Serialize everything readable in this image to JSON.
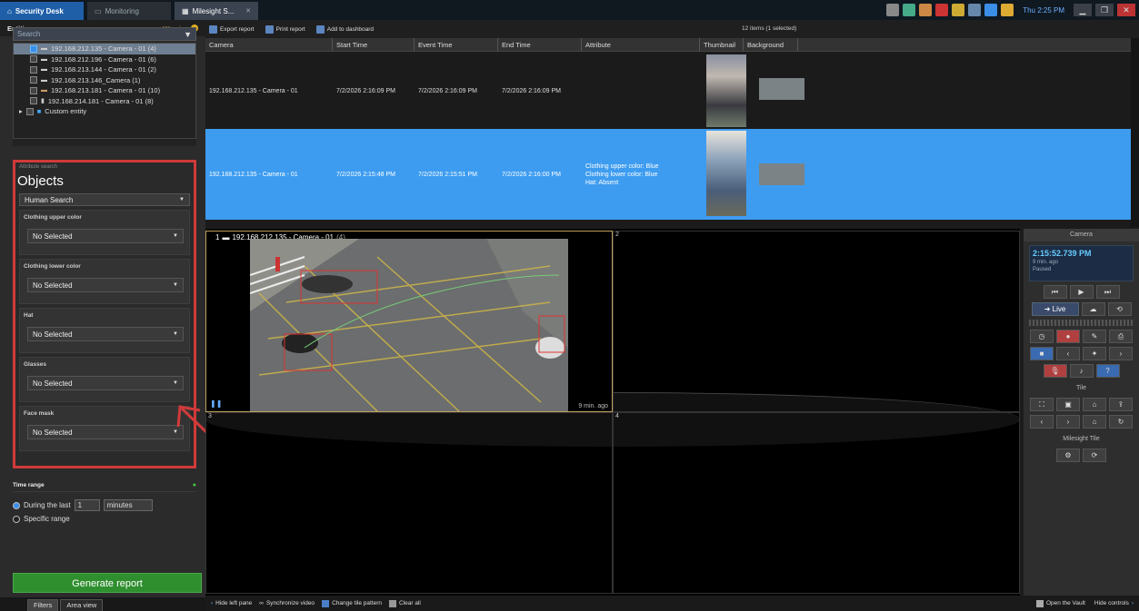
{
  "tabs": [
    {
      "label": "Security Desk"
    },
    {
      "label": "Monitoring"
    },
    {
      "label": "Milesight S..."
    }
  ],
  "tray": {
    "clock": "Thu 2:25 PM"
  },
  "entities": {
    "header": "Entities",
    "warning": "Warning",
    "search_placeholder": "Search",
    "items": [
      {
        "label": "192.168.212.135 - Camera - 01 (4)",
        "checked": true
      },
      {
        "label": "192.168.212.196 - Camera - 01 (6)",
        "checked": false
      },
      {
        "label": "192.168.213.144 - Camera - 01 (2)",
        "checked": false
      },
      {
        "label": "192.168.213.146_Camera (1)",
        "checked": false
      },
      {
        "label": "192.168.213.181 - Camera - 01 (10)",
        "checked": false
      },
      {
        "label": "192.168.214.181 - Camera - 01 (8)",
        "checked": false
      },
      {
        "label": "Custom entity",
        "checked": false
      }
    ]
  },
  "filters": {
    "section_title": "Attribute search",
    "heading": "Objects",
    "object_type": "Human Search",
    "groups": [
      {
        "label": "Clothing upper color",
        "value": "No Selected"
      },
      {
        "label": "Clothing lower color",
        "value": "No Selected"
      },
      {
        "label": "Hat",
        "value": "No Selected"
      },
      {
        "label": "Glasses",
        "value": "No Selected"
      },
      {
        "label": "Face mask",
        "value": "No Selected"
      }
    ]
  },
  "time_range": {
    "header": "Time range",
    "during_label": "During the last",
    "during_value": "1",
    "unit": "minutes",
    "specific_label": "Specific range"
  },
  "generate_label": "Generate report",
  "left_tabs": [
    "Filters",
    "Area view"
  ],
  "toolbar": {
    "export": "Export report",
    "print": "Print report",
    "dashboard": "Add to dashboard",
    "count": "12 items (1 selected)"
  },
  "grid": {
    "columns": [
      "Camera",
      "Start Time",
      "Event Time",
      "End Time",
      "Attribute",
      "Thumbnail",
      "Background"
    ],
    "rows": [
      {
        "camera": "192.168.212.135 - Camera - 01",
        "start": "7/2/2026 2:16:09 PM",
        "event": "7/2/2026 2:16:09 PM",
        "end": "7/2/2026 2:16:09 PM",
        "attr1": "",
        "attr2": "",
        "attr3": "",
        "selected": false
      },
      {
        "camera": "192.168.212.135 - Camera - 01",
        "start": "7/2/2026 2:15:48 PM",
        "event": "7/2/2026 2:15:51 PM",
        "end": "7/2/2026 2:16:00 PM",
        "attr1": "Clothing upper color: Blue",
        "attr2": "Clothing lower color: Blue",
        "attr3": "Hat: Absent",
        "selected": true
      }
    ]
  },
  "tiles": {
    "t1_num": "1",
    "t1_camera": "192.168.212.135 - Camera - 01",
    "t1_count": "(4)",
    "t1_ago": "9 min. ago",
    "t2_num": "2",
    "t3_num": "3",
    "t4_num": "4"
  },
  "bottombar": {
    "hide_left": "Hide left pane",
    "sync": "Synchronize video",
    "tile_pattern": "Change tile pattern",
    "clear": "Clear all",
    "vault": "Open the Vault",
    "hide_controls": "Hide controls"
  },
  "controls": {
    "header": "Camera",
    "time": "2:15:52.739 PM",
    "ago": "9 min. ago",
    "state": "Paused",
    "live": "Live",
    "tile_header": "Tile",
    "milesight_header": "Milesight Tile"
  }
}
